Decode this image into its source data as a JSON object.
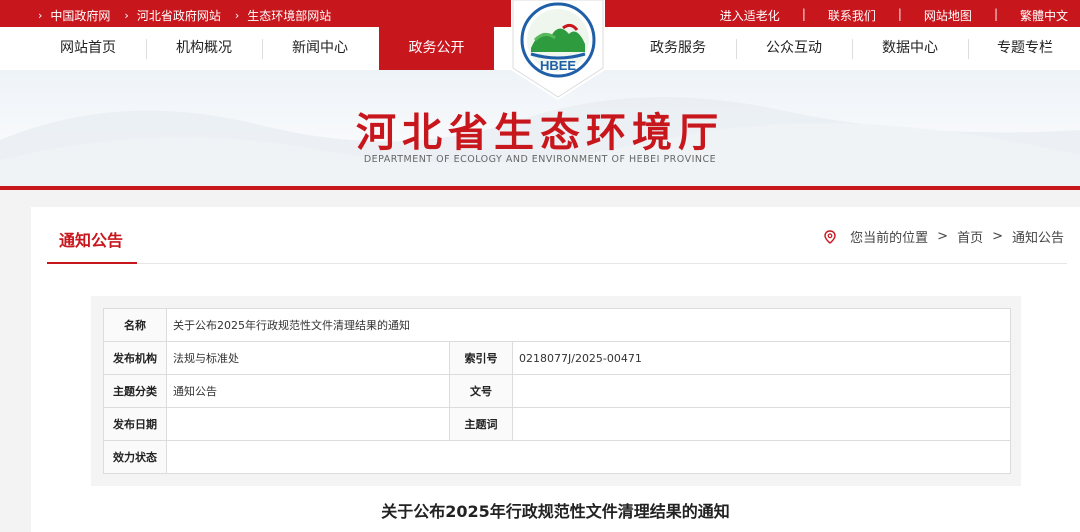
{
  "topbar": {
    "breadcrumbs": [
      "中国政府网",
      "河北省政府网站",
      "生态环境部网站"
    ],
    "links": [
      "进入适老化",
      "联系我们",
      "网站地图",
      "繁體中文"
    ],
    "separator": "|"
  },
  "logo": {
    "text": "HBEE"
  },
  "nav": {
    "items": [
      "网站首页",
      "机构概况",
      "新闻中心",
      "政务公开",
      "政务服务",
      "公众互动",
      "数据中心",
      "专题专栏"
    ],
    "active": "政务公开"
  },
  "banner": {
    "title": "河北省生态环境厅",
    "subtitle": "DEPARTMENT OF ECOLOGY AND ENVIRONMENT OF HEBEI PROVINCE"
  },
  "section": {
    "title": "通知公告",
    "location_label": "您当前的位置",
    "location_path": [
      "首页",
      "通知公告"
    ],
    "gt": ">"
  },
  "meta": {
    "name_label": "名称",
    "name_value": "关于公布2025年行政规范性文件清理结果的通知",
    "org_label": "发布机构",
    "org_value": "法规与标准处",
    "index_label": "索引号",
    "index_value": "0218077J/2025-00471",
    "category_label": "主题分类",
    "category_value": "通知公告",
    "docno_label": "文号",
    "docno_value": "",
    "date_label": "发布日期",
    "date_value": "",
    "keyword_label": "主题词",
    "keyword_value": "",
    "status_label": "效力状态",
    "status_value": ""
  },
  "document": {
    "title": "关于公布2025年行政规范性文件清理结果的通知"
  },
  "colors": {
    "brand": "#c8161d",
    "background": "#f3f3f3"
  },
  "icons": {
    "breadcrumb_arrow": "chevron-right-icon",
    "location": "location-pin-icon"
  }
}
